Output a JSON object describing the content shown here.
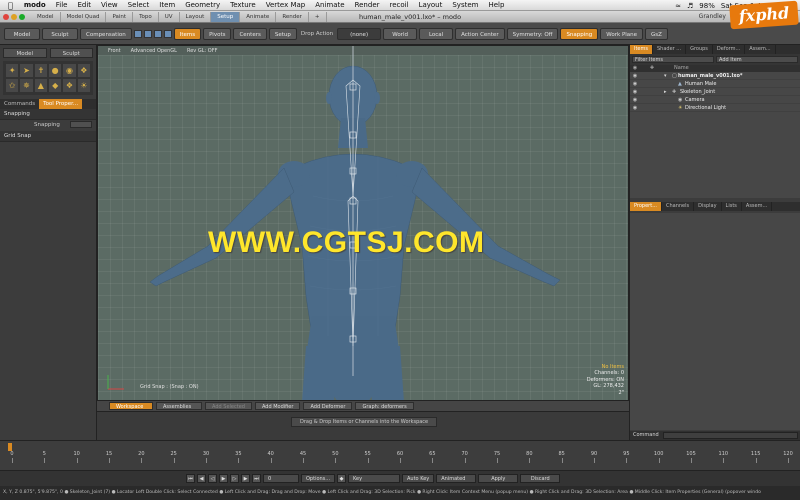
{
  "menubar": {
    "app": "modo",
    "items": [
      "File",
      "Edit",
      "View",
      "Select",
      "Item",
      "Geometry",
      "Texture",
      "Vertex Map",
      "Animate",
      "Render",
      "recoil",
      "Layout",
      "System",
      "Help"
    ],
    "battery": "98%",
    "clock": "Sat Sep 1  4:47 PM",
    "user": "Grandley"
  },
  "titlebar": {
    "title": "human_male_v001.lxo* – modo",
    "layout_tabs": [
      "Model",
      "Model Quad",
      "Paint",
      "Topo",
      "UV",
      "Layout",
      "Setup",
      "Animate",
      "Render",
      "+"
    ],
    "active_tab": "Setup",
    "logo": "fxphd"
  },
  "toolbar": {
    "model": "Model",
    "sculpt": "Sculpt",
    "compensation": "Compensation",
    "items": "Items",
    "pivots": "Pivots",
    "centers": "Centers",
    "setup": "Setup",
    "drop_action_label": "Drop Action",
    "drop_action_value": "(none)",
    "world": "World",
    "local": "Local",
    "action_center": "Action Center",
    "symmetry": "Symmetry: Off",
    "snapping": "Snapping",
    "work_plane": "Work Plane",
    "gsz": "GsZ"
  },
  "left_panel": {
    "tabs": [
      "Commands",
      "Tool Proper..."
    ],
    "section": "Snapping",
    "snapping_label": "Snapping",
    "snapping_value": "",
    "grid_snap": "Grid Snap"
  },
  "viewport": {
    "tabs": [
      "Front",
      "Advanced OpenGL",
      "Rev GL: OFF"
    ],
    "watermark": "WWW.CGTSJ.COM",
    "grid_snap_text": "Grid Snap : (Snap : ON)",
    "status": {
      "no_items": "No Items",
      "channels": "Channels: 0",
      "deformers": "Deformers: ON",
      "gl": "GL: 278,432",
      "unit": "2\""
    }
  },
  "workspace": {
    "buttons": [
      "Workspace",
      "Assemblies",
      "Add Selected",
      "Add Modifier",
      "Add Deformer",
      "Graph: deformers"
    ],
    "hint": "Drag & Drop Items or Channels into the Workspace"
  },
  "right_panel": {
    "top_tabs": [
      "Items",
      "Shader ...",
      "Groups",
      "Deform...",
      "Assem..."
    ],
    "filter_items": "Filter Items",
    "add_item": "Add Item",
    "header_name": "Name",
    "items": [
      {
        "label": "human_male_v001.lxo*",
        "indent": 0,
        "type": "scene"
      },
      {
        "label": "Human Male",
        "indent": 1,
        "type": "mesh"
      },
      {
        "label": "Skeleton_Joint",
        "indent": 1,
        "type": "locator"
      },
      {
        "label": "Camera",
        "indent": 1,
        "type": "camera"
      },
      {
        "label": "Directional Light",
        "indent": 1,
        "type": "light"
      }
    ],
    "bottom_tabs": [
      "Propert...",
      "Channels",
      "Display",
      "Lists",
      "Assem..."
    ],
    "command": "Command"
  },
  "timeline": {
    "ticks": [
      0,
      5,
      10,
      15,
      20,
      25,
      30,
      35,
      40,
      45,
      50,
      55,
      60,
      65,
      70,
      75,
      80,
      85,
      90,
      95,
      100,
      105,
      110,
      115,
      120
    ],
    "max": 120
  },
  "transport": {
    "frame": "0",
    "options": "Options...",
    "key": "Key",
    "auto_key": "Auto Key",
    "animated": "Animated",
    "apply": "Apply",
    "discard": "Discard"
  },
  "statusbar": {
    "text": "X, Y, Z   0.875\", 5'9.875\", 0   ● Skeleton_Joint (7) ● Locator    Left Double Click: Select Connected ● Left Click and Drag: Drag and Drop: Move ● Left Click and Drag: 3D Selection: Pick ● Right Click: Item Context Menu (popup menu) ● Right Click and Drag: 3D Selection: Area ● Middle Click: Item Properties (General) (popover windo"
  }
}
